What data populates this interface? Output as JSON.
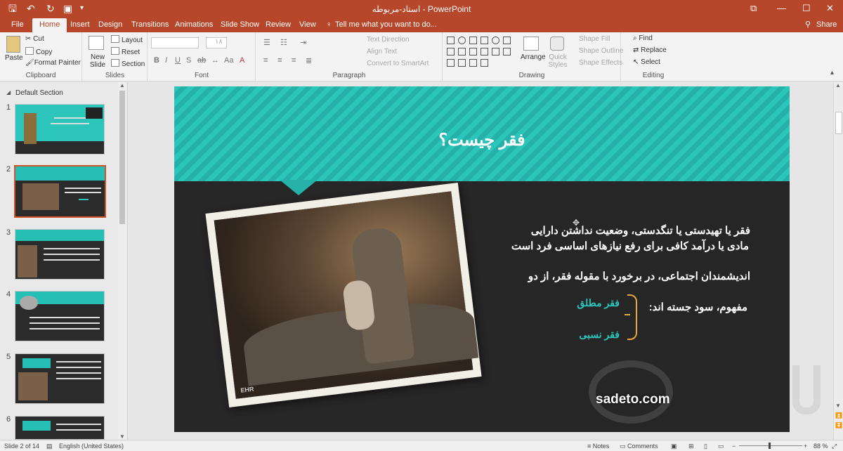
{
  "titlebar": {
    "document_title": "استاد-مربوطه - PowerPoint"
  },
  "tabs": [
    "File",
    "Home",
    "Insert",
    "Design",
    "Transitions",
    "Animations",
    "Slide Show",
    "Review",
    "View"
  ],
  "tell_me": "Tell me what you want to do...",
  "share": "Share",
  "clipboard": {
    "paste": "Paste",
    "cut": "Cut",
    "copy": "Copy",
    "format_painter": "Format Painter",
    "label": "Clipboard"
  },
  "slides_group": {
    "new_slide": "New Slide",
    "layout": "Layout",
    "reset": "Reset",
    "section": "Section",
    "label": "Slides"
  },
  "font_group": {
    "font_size": "١٨",
    "label": "Font"
  },
  "paragraph_group": {
    "text_direction": "Text Direction",
    "align_text": "Align Text",
    "convert_smartart": "Convert to SmartArt",
    "label": "Paragraph"
  },
  "drawing_group": {
    "arrange": "Arrange",
    "quick_styles": "Quick Styles",
    "shape_fill": "Shape Fill",
    "shape_outline": "Shape Outline",
    "shape_effects": "Shape Effects",
    "label": "Drawing"
  },
  "editing_group": {
    "find": "Find",
    "replace": "Replace",
    "select": "Select",
    "label": "Editing"
  },
  "section_name": "Default Section",
  "thumbnails": [
    "1",
    "2",
    "3",
    "4",
    "5",
    "6"
  ],
  "slide": {
    "title": "فقر چیست؟",
    "line1": "فقر یا تهیدستی یا تنگدستی، وضعیت نداشتن دارایی",
    "line2": "مادی یا درآمد کافی برای رفع نیازهای اساسی فرد است",
    "line3": "اندیشمندان اجتماعی، در برخورد با مقوله فقر، از دو",
    "line4": "مفهوم، سود جسته اند:",
    "option1": "فقر مطلق",
    "option2": "فقر نسبی",
    "photo_watermark": "EHR",
    "site": "sadeto.com"
  },
  "status": {
    "slide_count": "Slide 2 of 14",
    "language": "English (United States)",
    "notes": "Notes",
    "comments": "Comments",
    "zoom": "88 %"
  }
}
